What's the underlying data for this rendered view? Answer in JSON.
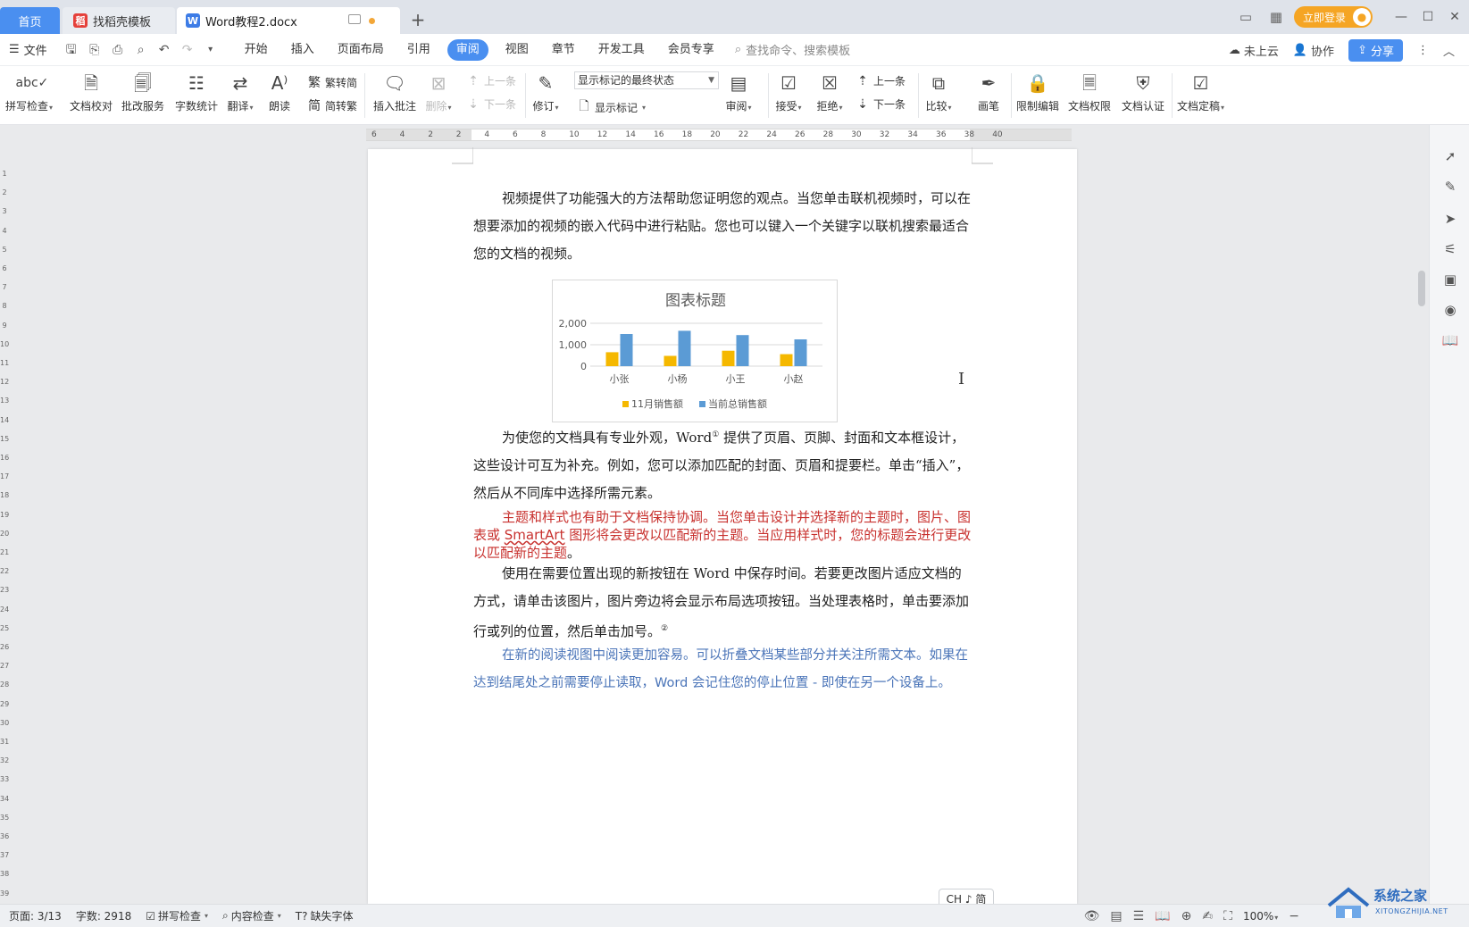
{
  "tabs": {
    "home": "首页",
    "template": "找稻壳模板",
    "doc": "Word教程2.docx",
    "new_tab": "+"
  },
  "titlebar": {
    "login": "立即登录"
  },
  "menu": {
    "file": "文件",
    "items": [
      "开始",
      "插入",
      "页面布局",
      "引用",
      "审阅",
      "视图",
      "章节",
      "开发工具",
      "会员专享"
    ],
    "active_index": 4,
    "search": "查找命令、搜索模板",
    "cloud": "未上云",
    "collab": "协作",
    "share": "分享"
  },
  "ribbon": {
    "spell": "拼写检查",
    "proof": "文档校对",
    "correct": "批改服务",
    "wordcount": "字数统计",
    "translate": "翻译",
    "read": "朗读",
    "trad_simp": "繁转简",
    "simp_trad": "简转繁",
    "insert_comment": "插入批注",
    "delete": "删除",
    "prev1": "上一条",
    "next1": "下一条",
    "revise": "修订",
    "show_state": "显示标记的最终状态",
    "show_marks": "显示标记",
    "review": "审阅",
    "accept": "接受",
    "reject": "拒绝",
    "prev2": "上一条",
    "next2": "下一条",
    "compare": "比较",
    "pen": "画笔",
    "restrict": "限制编辑",
    "rights": "文档权限",
    "auth": "文档认证",
    "finalize": "文档定稿"
  },
  "ruler": {
    "labels": [
      "6",
      "4",
      "2",
      "2",
      "4",
      "6",
      "8",
      "10",
      "12",
      "14",
      "16",
      "18",
      "20",
      "22",
      "24",
      "26",
      "28",
      "30",
      "32",
      "34",
      "36",
      "38",
      "40"
    ],
    "vlabels": [
      "1",
      "2",
      "3",
      "4",
      "5",
      "6",
      "7",
      "8",
      "9",
      "10",
      "11",
      "12",
      "13",
      "14",
      "15",
      "16",
      "17",
      "18",
      "19",
      "20",
      "21",
      "22",
      "23",
      "24",
      "25",
      "26",
      "27",
      "28",
      "29",
      "30",
      "31",
      "32",
      "33",
      "34",
      "35",
      "36",
      "37",
      "38",
      "39"
    ]
  },
  "document": {
    "p1": "视频提供了功能强大的方法帮助您证明您的观点。当您单击联机视频时，可以在想要添加的视频的嵌入代码中进行粘贴。您也可以键入一个关键字以联机搜索最适合您的文档的视频。",
    "p2_a": "为使您的文档具有专业外观，Word",
    "p2_sup": "①",
    "p2_b": " 提供了页眉、页脚、封面和文本框设计，这些设计可互为补充。例如，您可以添加匹配的封面、页眉和提要栏。单击“插入”，然后从不同库中选择所需元素。",
    "p3_a": "主题和样式也有助于文档保持协调。当您单击设计并选择新的主题时，图片、图表或 ",
    "p3_smartart": "SmartArt",
    "p3_b": " 图形将会更改以匹配新的主题。当应用样式时，您的标题会进行更改以匹配新的主题",
    "p3_end": "。",
    "p4_a": "使用在需要位置出现的新按钮在 Word 中保存时间。若要更改图片适应文档的方式，请单击该图片，图片旁边将会显示布局选项按钮。当处理表格时，单击要添加行或列的位置，然后单击加号。",
    "p4_sup": "②",
    "p5": "在新的阅读视图中阅读更加容易。可以折叠文档某些部分并关注所需文本。如果在达到结尾处之前需要停止读取，Word 会记住您的停止位置 - 即使在另一个设备上。"
  },
  "chart_data": {
    "type": "bar",
    "title": "图表标题",
    "categories": [
      "小张",
      "小杨",
      "小王",
      "小赵"
    ],
    "series": [
      {
        "name": "11月销售额",
        "values": [
          650,
          480,
          720,
          560
        ],
        "color": "#f5b800"
      },
      {
        "name": "当前总销售额",
        "values": [
          1500,
          1650,
          1450,
          1250
        ],
        "color": "#5b9bd5"
      }
    ],
    "ylim": [
      0,
      2000
    ],
    "yticks": [
      "2,000",
      "1,000",
      "0"
    ],
    "legend": "bottom",
    "grid": true
  },
  "status": {
    "page": "页面: 3/13",
    "words": "字数: 2918",
    "spell": "拼写检查",
    "content": "内容检查",
    "missing_font": "缺失字体",
    "zoom": "100%"
  },
  "ime": "CH ♪ 简",
  "watermark": {
    "line1": "系统之家",
    "line2": "XITONGZHIJIA.NET"
  }
}
